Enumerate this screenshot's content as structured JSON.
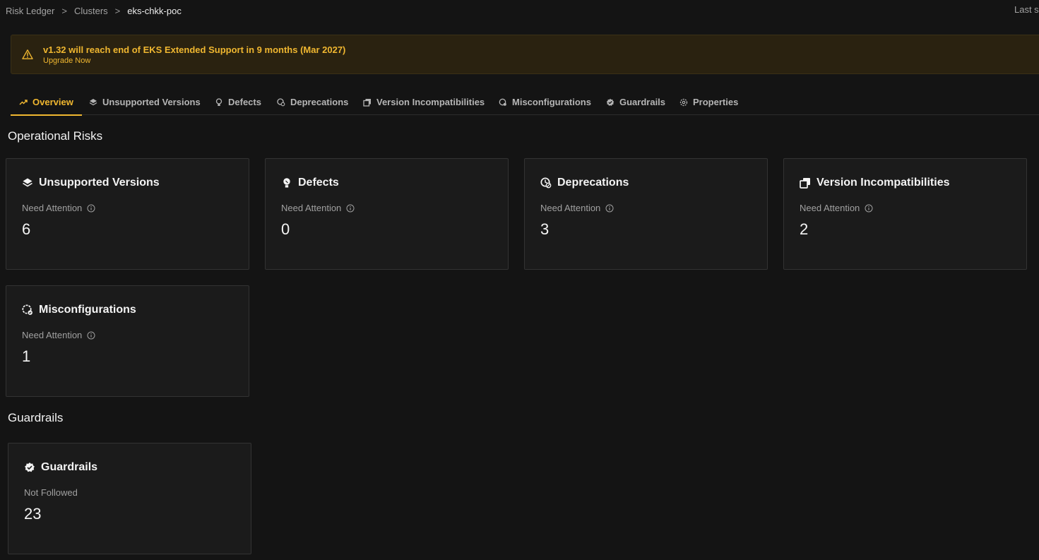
{
  "breadcrumb": {
    "items": [
      "Risk Ledger",
      "Clusters",
      "eks-chkk-poc"
    ],
    "separator": ">",
    "right_text": "Last s"
  },
  "banner": {
    "message": "v1.32 will reach end of EKS Extended Support in 9 months (Mar 2027)",
    "cta": "Upgrade Now",
    "icon": "warning-triangle-icon",
    "color": "#f0b730"
  },
  "tabs": [
    {
      "label": "Overview",
      "icon": "trend-icon",
      "active": true
    },
    {
      "label": "Unsupported Versions",
      "icon": "stack-icon"
    },
    {
      "label": "Defects",
      "icon": "bulb-icon"
    },
    {
      "label": "Deprecations",
      "icon": "clock-ban-icon"
    },
    {
      "label": "Version Incompatibilities",
      "icon": "copy-icon"
    },
    {
      "label": "Misconfigurations",
      "icon": "gear-check-icon"
    },
    {
      "label": "Guardrails",
      "icon": "shield-check-icon"
    },
    {
      "label": "Properties",
      "icon": "settings-icon"
    }
  ],
  "sections": {
    "operational_risks": "Operational Risks",
    "guardrails": "Guardrails"
  },
  "cards": [
    {
      "title": "Unsupported Versions",
      "sub": "Need Attention",
      "count": "6",
      "icon": "stack-icon"
    },
    {
      "title": "Defects",
      "sub": "Need Attention",
      "count": "0",
      "icon": "bulb-icon"
    },
    {
      "title": "Deprecations",
      "sub": "Need Attention",
      "count": "3",
      "icon": "clock-ban-icon"
    },
    {
      "title": "Version Incompatibilities",
      "sub": "Need Attention",
      "count": "2",
      "icon": "copy-icon"
    },
    {
      "title": "Misconfigurations",
      "sub": "Need Attention",
      "count": "1",
      "icon": "gear-check-icon"
    }
  ],
  "guardrail_card": {
    "title": "Guardrails",
    "sub": "Not Followed",
    "count": "23",
    "icon": "shield-check-icon"
  },
  "colors": {
    "accent": "#f0b730",
    "background": "#141414",
    "card": "#1b1b1b"
  }
}
